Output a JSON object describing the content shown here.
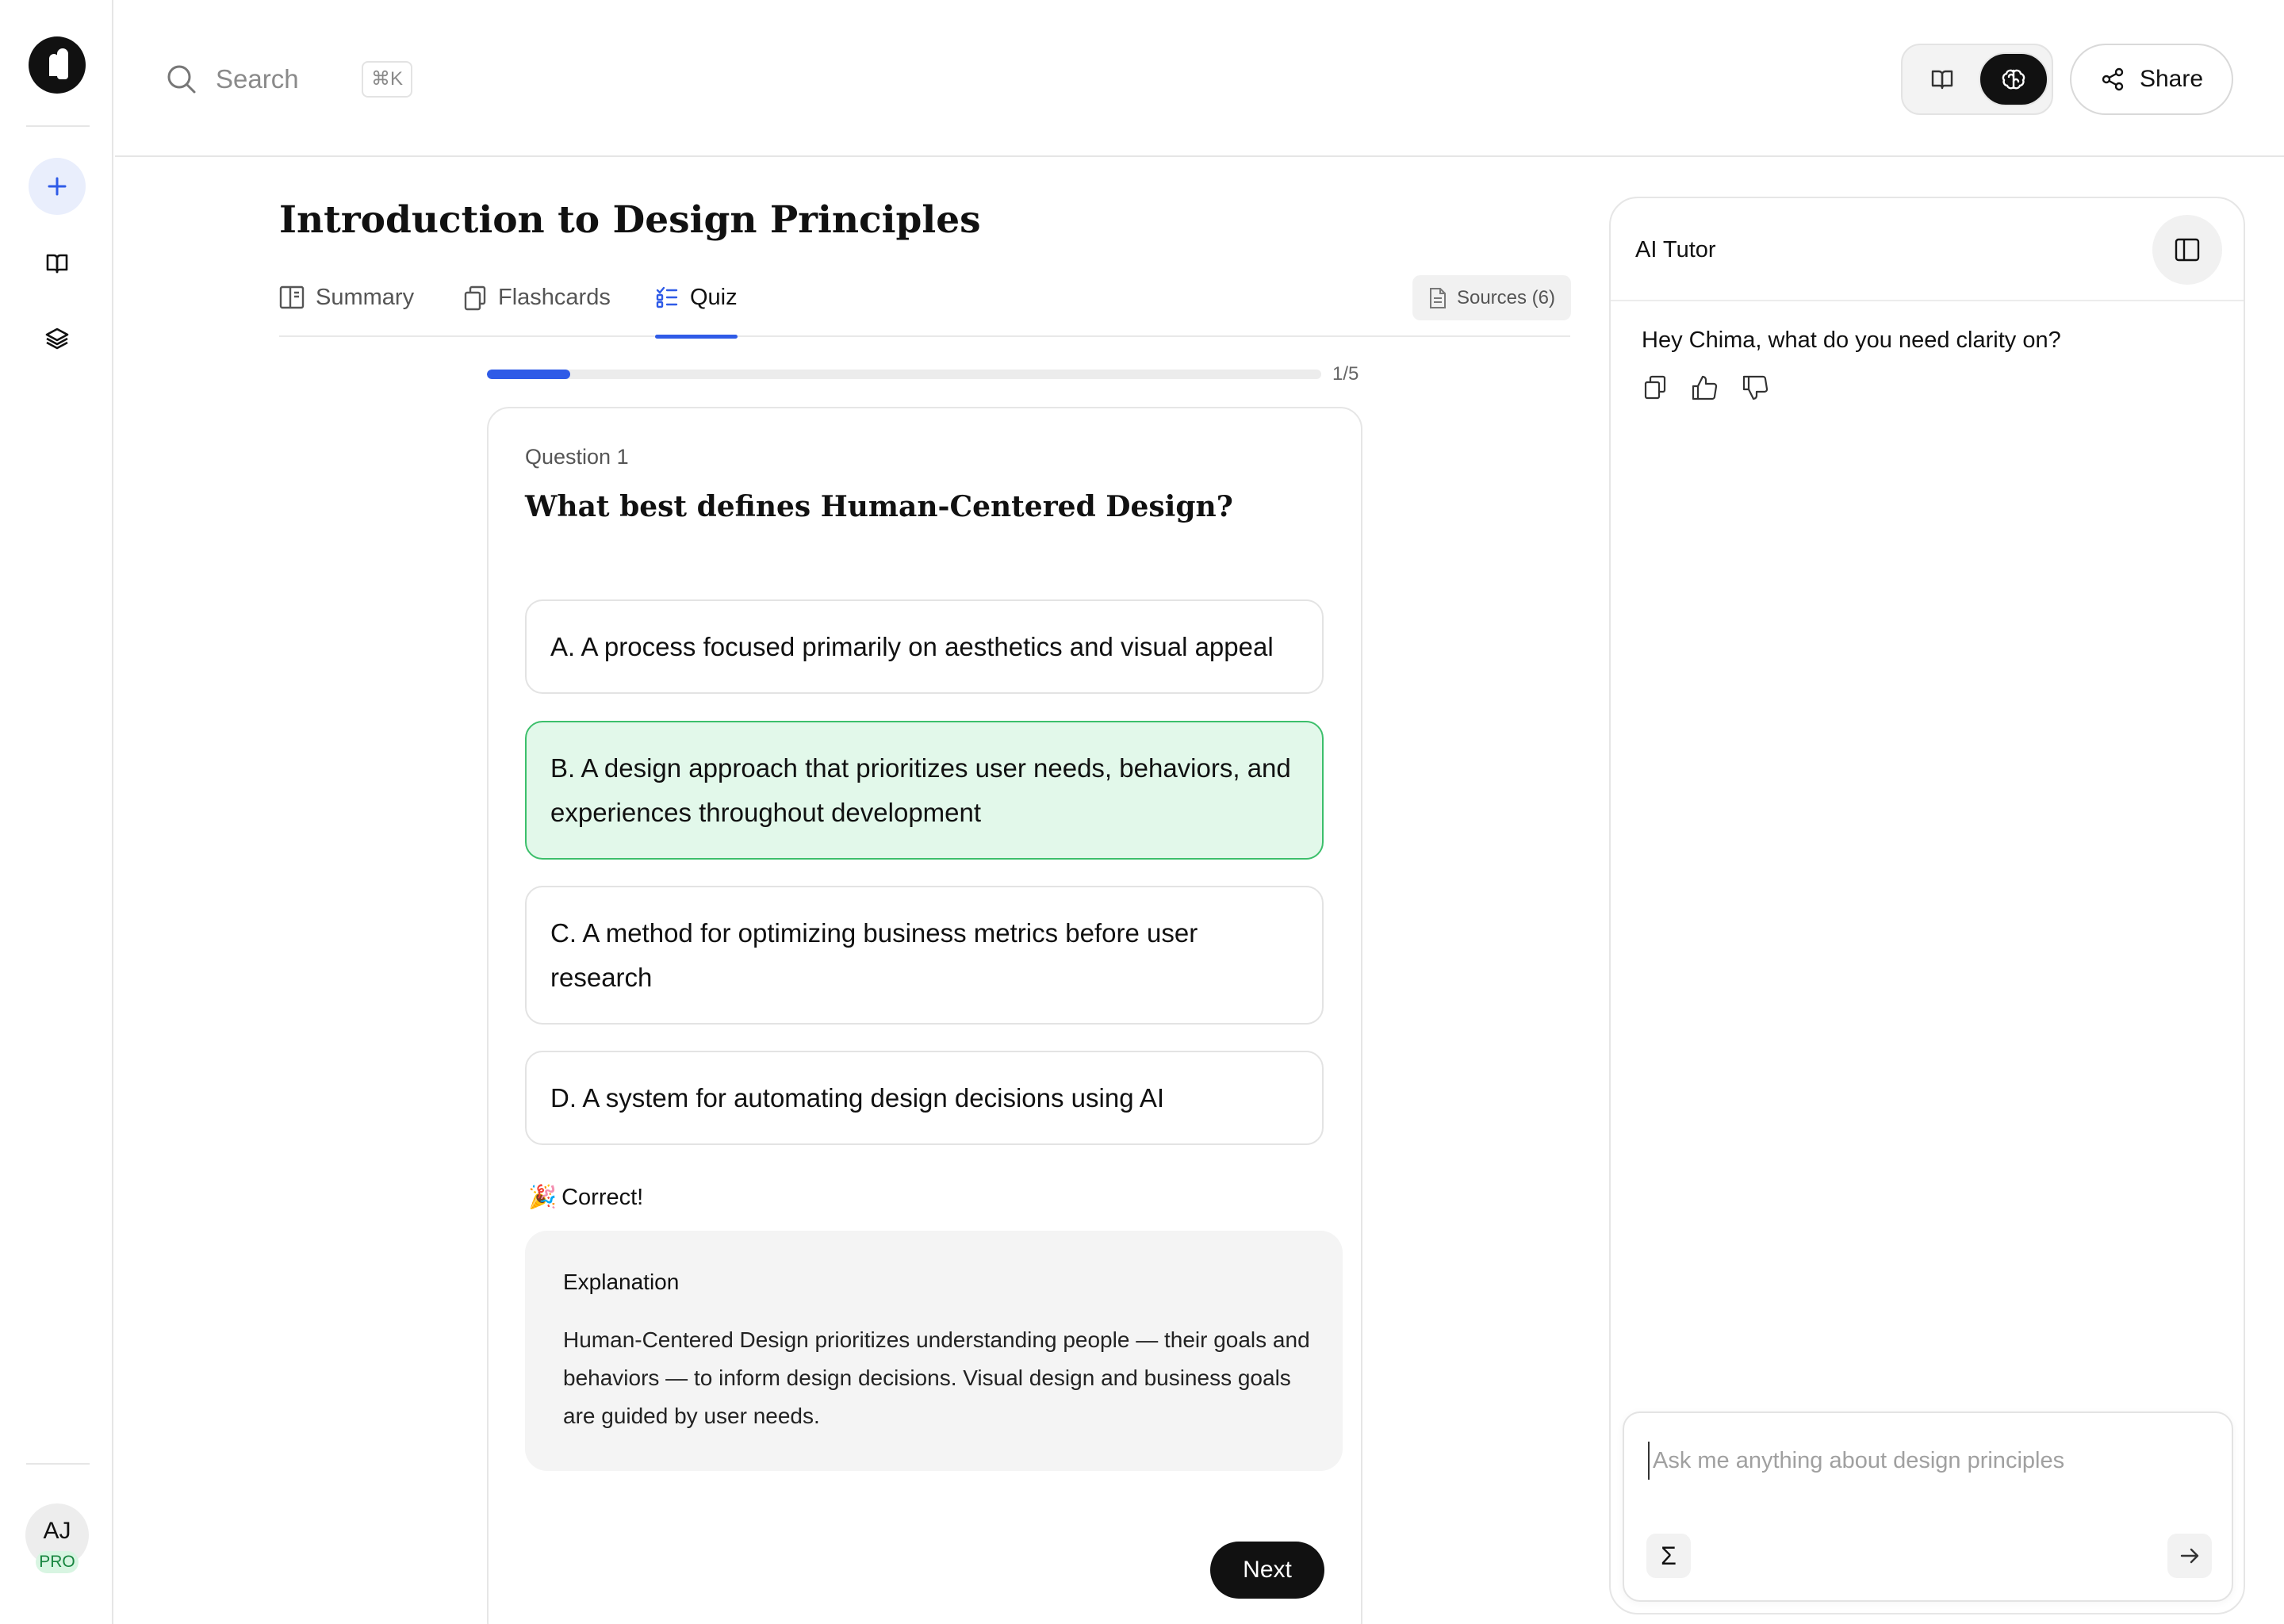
{
  "search": {
    "placeholder": "Search",
    "shortcut": "⌘K"
  },
  "user": {
    "initials": "AJ",
    "badge": "PRO"
  },
  "header": {
    "share_label": "Share"
  },
  "page": {
    "title": "Introduction to Design Principles"
  },
  "tabs": [
    {
      "label": "Summary",
      "icon": "book-open-icon"
    },
    {
      "label": "Flashcards",
      "icon": "cards-icon"
    },
    {
      "label": "Quiz",
      "icon": "checklist-icon",
      "active": true
    }
  ],
  "sources": {
    "label": "Sources (6)"
  },
  "quiz": {
    "progress_text": "1/5",
    "progress_fraction": 0.1,
    "question_label": "Question 1",
    "question": "What best defines Human-Centered Design?",
    "options": [
      {
        "text": "A. A process focused primarily on aesthetics and visual appeal"
      },
      {
        "text": "B. A design approach that prioritizes user needs, behaviors, and experiences throughout development",
        "state": "correct"
      },
      {
        "text": "C. A method for optimizing business metrics before user research"
      },
      {
        "text": "D. A system for automating design decisions using AI"
      }
    ],
    "feedback_emoji": "🎉",
    "feedback": "Correct!",
    "explanation_title": "Explanation",
    "explanation": "Human-Centered Design prioritizes understanding people — their goals and behaviors — to inform design decisions. Visual design and business goals are guided by user needs.",
    "next_label": "Next"
  },
  "tutor": {
    "title": "AI Tutor",
    "greeting": "Hey Chima, what do you need clarity on?",
    "input_placeholder": "Ask me anything about design principles",
    "sigma_label": "Σ"
  },
  "colors": {
    "accent": "#2f5be7",
    "correct_bg": "#e2f8ea",
    "correct_border": "#3cbf6b",
    "dark": "#111111"
  }
}
